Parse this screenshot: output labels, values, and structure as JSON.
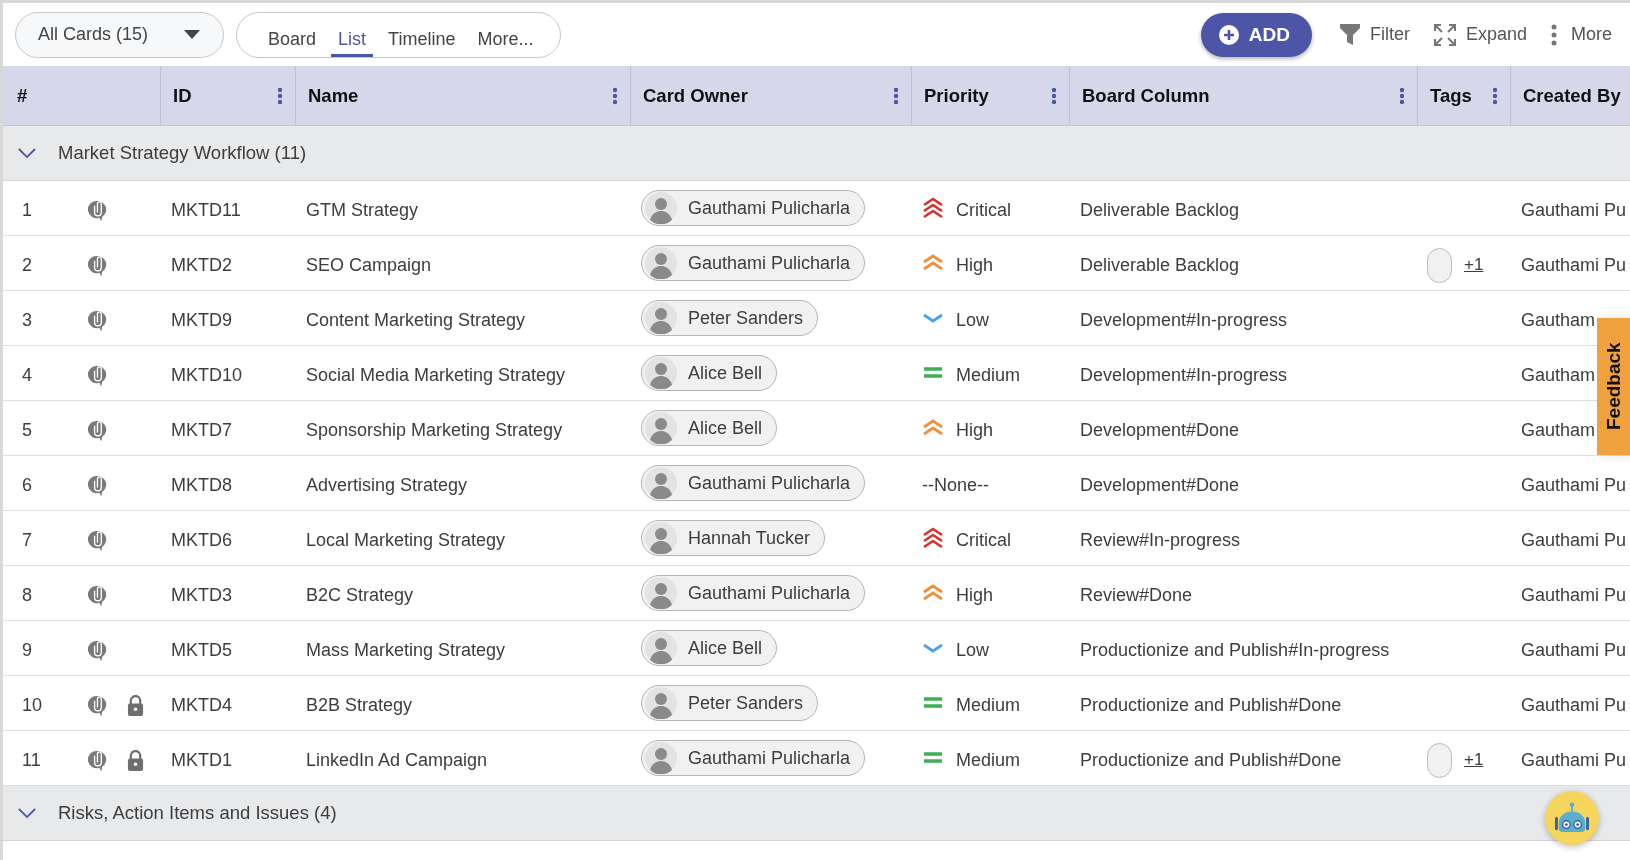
{
  "toolbar": {
    "card_filter": "All Cards (15)",
    "views": [
      {
        "label": "Board",
        "selected": false
      },
      {
        "label": "List",
        "selected": true
      },
      {
        "label": "Timeline",
        "selected": false
      },
      {
        "label": "More...",
        "selected": false
      }
    ],
    "add_button": "ADD",
    "actions": [
      {
        "kind": "filter",
        "label": "Filter"
      },
      {
        "kind": "expand",
        "label": "Expand"
      },
      {
        "kind": "more",
        "label": "More"
      }
    ]
  },
  "table": {
    "columns": [
      {
        "label": "#",
        "menu": false
      },
      {
        "label": "ID",
        "menu": true
      },
      {
        "label": "Name",
        "menu": true
      },
      {
        "label": "Card Owner",
        "menu": true
      },
      {
        "label": "Priority",
        "menu": true
      },
      {
        "label": "Board Column",
        "menu": true
      },
      {
        "label": "Tags",
        "menu": true
      },
      {
        "label": "Created By",
        "menu": false
      }
    ],
    "groups": [
      {
        "title": "Market Strategy Workflow (11)",
        "expanded": true,
        "rows": [
          {
            "number": "1",
            "locked": false,
            "id": "MKTD11",
            "name": "GTM Strategy",
            "owner": "Gauthami Pulicharla",
            "priority": {
              "kind": "critical",
              "label": "Critical"
            },
            "board_column": "Deliverable Backlog",
            "created_by": "Gauthami Pu"
          },
          {
            "number": "2",
            "locked": false,
            "id": "MKTD2",
            "name": "SEO Campaign",
            "owner": "Gauthami Pulicharla",
            "priority": {
              "kind": "high",
              "label": "High"
            },
            "board_column": "Deliverable Backlog",
            "tags_more": "+1",
            "created_by": "Gauthami Pu"
          },
          {
            "number": "3",
            "locked": false,
            "id": "MKTD9",
            "name": "Content Marketing Strategy",
            "owner": "Peter Sanders",
            "priority": {
              "kind": "low",
              "label": "Low"
            },
            "board_column": "Development#In-progress",
            "created_by": "Gautham"
          },
          {
            "number": "4",
            "locked": false,
            "id": "MKTD10",
            "name": "Social Media Marketing Strategy",
            "owner": "Alice Bell",
            "priority": {
              "kind": "medium",
              "label": "Medium"
            },
            "board_column": "Development#In-progress",
            "created_by": "Gautham"
          },
          {
            "number": "5",
            "locked": false,
            "id": "MKTD7",
            "name": "Sponsorship Marketing Strategy",
            "owner": "Alice Bell",
            "priority": {
              "kind": "high",
              "label": "High"
            },
            "board_column": "Development#Done",
            "created_by": "Gautham"
          },
          {
            "number": "6",
            "locked": false,
            "id": "MKTD8",
            "name": "Advertising Strategy",
            "owner": "Gauthami Pulicharla",
            "priority": {
              "kind": "none",
              "label": "--None--"
            },
            "board_column": "Development#Done",
            "created_by": "Gauthami Pu"
          },
          {
            "number": "7",
            "locked": false,
            "id": "MKTD6",
            "name": "Local Marketing Strategy",
            "owner": "Hannah Tucker",
            "priority": {
              "kind": "critical",
              "label": "Critical"
            },
            "board_column": "Review#In-progress",
            "created_by": "Gauthami Pu"
          },
          {
            "number": "8",
            "locked": false,
            "id": "MKTD3",
            "name": "B2C Strategy",
            "owner": "Gauthami Pulicharla",
            "priority": {
              "kind": "high",
              "label": "High"
            },
            "board_column": "Review#Done",
            "created_by": "Gauthami Pu"
          },
          {
            "number": "9",
            "locked": false,
            "id": "MKTD5",
            "name": "Mass Marketing Strategy",
            "owner": "Alice Bell",
            "priority": {
              "kind": "low",
              "label": "Low"
            },
            "board_column": "Productionize and Publish#In-progress",
            "created_by": "Gauthami Pu"
          },
          {
            "number": "10",
            "locked": true,
            "id": "MKTD4",
            "name": "B2B Strategy",
            "owner": "Peter Sanders",
            "priority": {
              "kind": "medium",
              "label": "Medium"
            },
            "board_column": "Productionize and Publish#Done",
            "created_by": "Gauthami Pu"
          },
          {
            "number": "11",
            "locked": true,
            "id": "MKTD1",
            "name": "LinkedIn Ad Campaign",
            "owner": "Gauthami Pulicharla",
            "priority": {
              "kind": "medium",
              "label": "Medium"
            },
            "board_column": "Productionize and Publish#Done",
            "tags_more": "+1",
            "created_by": "Gauthami Pu"
          }
        ]
      },
      {
        "title": "Risks, Action Items and Issues (4)",
        "expanded": true
      }
    ]
  },
  "feedback_tab": "Feedback"
}
